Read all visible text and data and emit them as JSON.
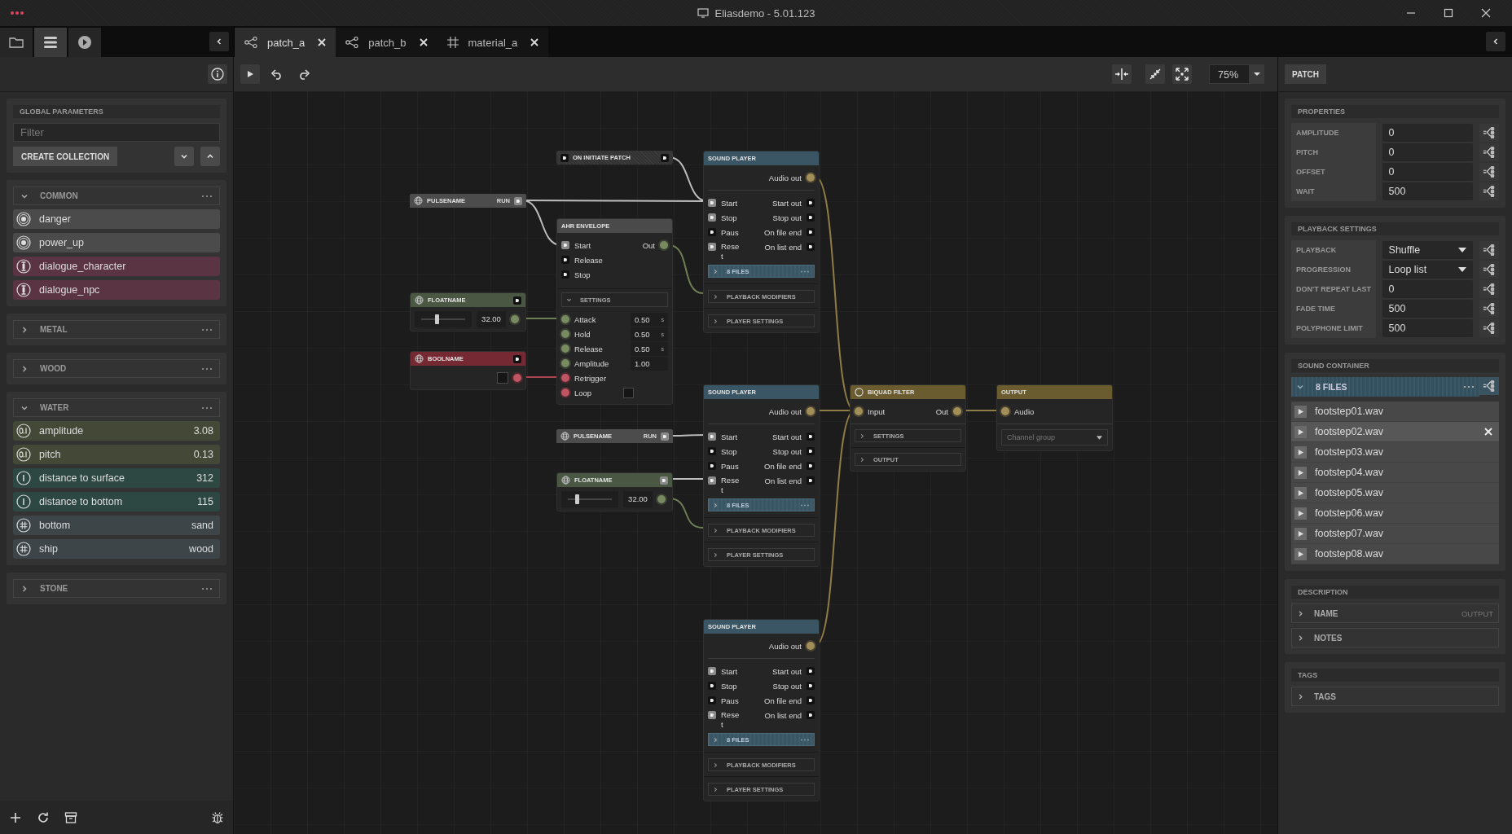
{
  "window": {
    "title": "Eliasdemo - 5.01.123"
  },
  "side_tabs": [
    {
      "kind": "folder",
      "selected": false
    },
    {
      "kind": "list",
      "selected": true
    },
    {
      "kind": "play",
      "selected": false
    }
  ],
  "tabs": [
    {
      "label": "patch_a",
      "kind": "patch",
      "selected": true
    },
    {
      "label": "patch_b",
      "kind": "patch",
      "selected": false
    },
    {
      "label": "material_a",
      "kind": "material",
      "selected": false
    }
  ],
  "left_panel": {
    "title": "GLOBAL PARAMETERS",
    "filter_placeholder": "Filter",
    "create_button": "CREATE COLLECTION",
    "collections": [
      {
        "name": "COMMON",
        "expanded": true,
        "params": [
          {
            "name": "danger",
            "kind": "trigger"
          },
          {
            "name": "power_up",
            "kind": "trigger"
          },
          {
            "name": "dialogue_character",
            "kind": "text"
          },
          {
            "name": "dialogue_npc",
            "kind": "text"
          }
        ]
      },
      {
        "name": "METAL",
        "expanded": false
      },
      {
        "name": "WOOD",
        "expanded": false
      },
      {
        "name": "WATER",
        "expanded": true,
        "params": [
          {
            "name": "amplitude",
            "kind": "float",
            "value": "3.08"
          },
          {
            "name": "pitch",
            "kind": "float",
            "value": "0.13"
          },
          {
            "name": "distance to surface",
            "kind": "int",
            "value": "312"
          },
          {
            "name": "distance to bottom",
            "kind": "int",
            "value": "115"
          },
          {
            "name": "bottom",
            "kind": "enum",
            "value": "sand"
          },
          {
            "name": "ship",
            "kind": "enum",
            "value": "wood"
          }
        ]
      },
      {
        "name": "STONE",
        "expanded": false
      }
    ]
  },
  "toolbar": {
    "zoom": "75%"
  },
  "nodes": [
    {
      "kind": "pulse",
      "title": "PULSENAME",
      "action": "RUN"
    },
    {
      "kind": "float",
      "title": "FLOATNAME",
      "value": "32.00",
      "level": 0.35
    },
    {
      "kind": "bool",
      "title": "BOOLNAME",
      "checked": false
    },
    {
      "kind": "event",
      "title": "ON INITIATE PATCH"
    },
    {
      "kind": "envelope",
      "title": "AHR ENVELOPE",
      "output": "Out",
      "inputs": [
        {
          "label": "Start",
          "active": true
        },
        {
          "label": "Release",
          "active": false
        },
        {
          "label": "Stop",
          "active": false
        }
      ],
      "settings_label": "SETTINGS",
      "settings": [
        {
          "kind": "number",
          "label": "Attack",
          "value": "0.50",
          "unit": "s"
        },
        {
          "kind": "number",
          "label": "Hold",
          "value": "0.50",
          "unit": "s"
        },
        {
          "kind": "number",
          "label": "Release",
          "value": "0.50",
          "unit": "s"
        },
        {
          "kind": "number",
          "label": "Amplitude",
          "value": "1.00"
        },
        {
          "kind": "bool_port",
          "label": "Retrigger"
        },
        {
          "kind": "bool",
          "label": "Loop",
          "checked": false
        }
      ]
    },
    {
      "kind": "pulse",
      "title": "PULSENAME",
      "action": "RUN"
    },
    {
      "kind": "float",
      "title": "FLOATNAME",
      "value": "32.00",
      "level": 0.2
    },
    {
      "kind": "sound_player",
      "title": "SOUND PLAYER",
      "output": "Audio out",
      "inputs": [
        {
          "label": "Start",
          "out": "Start out",
          "active": true
        },
        {
          "label": "Stop",
          "out": "Stop out",
          "active": true
        },
        {
          "label": "Paus",
          "out": "On file end",
          "active": false
        },
        {
          "label": "Reset",
          "out": "On list end",
          "active": true
        }
      ],
      "files": "8 FILES",
      "sections": [
        "PLAYBACK MODIFIERS",
        "PLAYER SETTINGS"
      ]
    },
    {
      "kind": "sound_player",
      "title": "SOUND PLAYER",
      "output": "Audio out",
      "inputs": [
        {
          "label": "Start",
          "out": "Start out",
          "active": true
        },
        {
          "label": "Stop",
          "out": "Stop out",
          "active": false
        },
        {
          "label": "Paus",
          "out": "On file end",
          "active": false
        },
        {
          "label": "Reset",
          "out": "On list end",
          "active": true
        }
      ],
      "files": "8 FILES",
      "sections": [
        "PLAYBACK MODIFIERS",
        "PLAYER SETTINGS"
      ]
    },
    {
      "kind": "sound_player",
      "title": "SOUND PLAYER",
      "output": "Audio out",
      "inputs": [
        {
          "label": "Start",
          "out": "Start out",
          "active": true
        },
        {
          "label": "Stop",
          "out": "Stop out",
          "active": false
        },
        {
          "label": "Paus",
          "out": "On file end",
          "active": false
        },
        {
          "label": "Reset",
          "out": "On list end",
          "active": true
        }
      ],
      "files": "8 FILES",
      "sections": [
        "PLAYBACK MODIFIERS",
        "PLAYER SETTINGS"
      ]
    },
    {
      "kind": "filter",
      "title": "BIQUAD FILTER",
      "input": "Input",
      "output": "Out",
      "sections": [
        "SETTINGS",
        "OUTPUT"
      ]
    },
    {
      "kind": "output",
      "title": "OUTPUT",
      "input": "Audio",
      "select_placeholder": "Channel group"
    }
  ],
  "right_panel": {
    "header_button": "PATCH",
    "properties": {
      "title": "PROPERTIES",
      "rows": [
        {
          "label": "AMPLITUDE",
          "value": "0",
          "kind": "input"
        },
        {
          "label": "PITCH",
          "value": "0",
          "kind": "input"
        },
        {
          "label": "OFFSET",
          "value": "0",
          "kind": "input"
        },
        {
          "label": "WAIT",
          "value": "500",
          "kind": "input"
        }
      ]
    },
    "playback_settings": {
      "title": "PLAYBACK SETTINGS",
      "rows": [
        {
          "label": "PLAYBACK",
          "value": "Shuffle",
          "kind": "select"
        },
        {
          "label": "PROGRESSION",
          "value": "Loop list",
          "kind": "select"
        },
        {
          "label": "DON'T REPEAT LAST",
          "value": "0",
          "kind": "input"
        },
        {
          "label": "FADE TIME",
          "value": "500",
          "kind": "input"
        },
        {
          "label": "POLYPHONE LIMIT",
          "value": "500",
          "kind": "input"
        }
      ]
    },
    "sound_container": {
      "title": "SOUND CONTAINER",
      "files_label": "8 FILES",
      "expanded": true,
      "files": [
        {
          "name": "footstep01.wav",
          "selected": false
        },
        {
          "name": "footstep02.wav",
          "selected": true
        },
        {
          "name": "footstep03.wav",
          "selected": false
        },
        {
          "name": "footstep04.wav",
          "selected": false
        },
        {
          "name": "footstep05.wav",
          "selected": false
        },
        {
          "name": "footstep06.wav",
          "selected": false
        },
        {
          "name": "footstep07.wav",
          "selected": false
        },
        {
          "name": "footstep08.wav",
          "selected": false
        }
      ]
    },
    "description": {
      "title": "DESCRIPTION",
      "rows": [
        {
          "label": "NAME",
          "placeholder": "OUTPUT"
        },
        {
          "label": "NOTES"
        }
      ]
    },
    "tags": {
      "title": "TAGS",
      "rows": [
        {
          "label": "TAGS"
        }
      ]
    }
  }
}
